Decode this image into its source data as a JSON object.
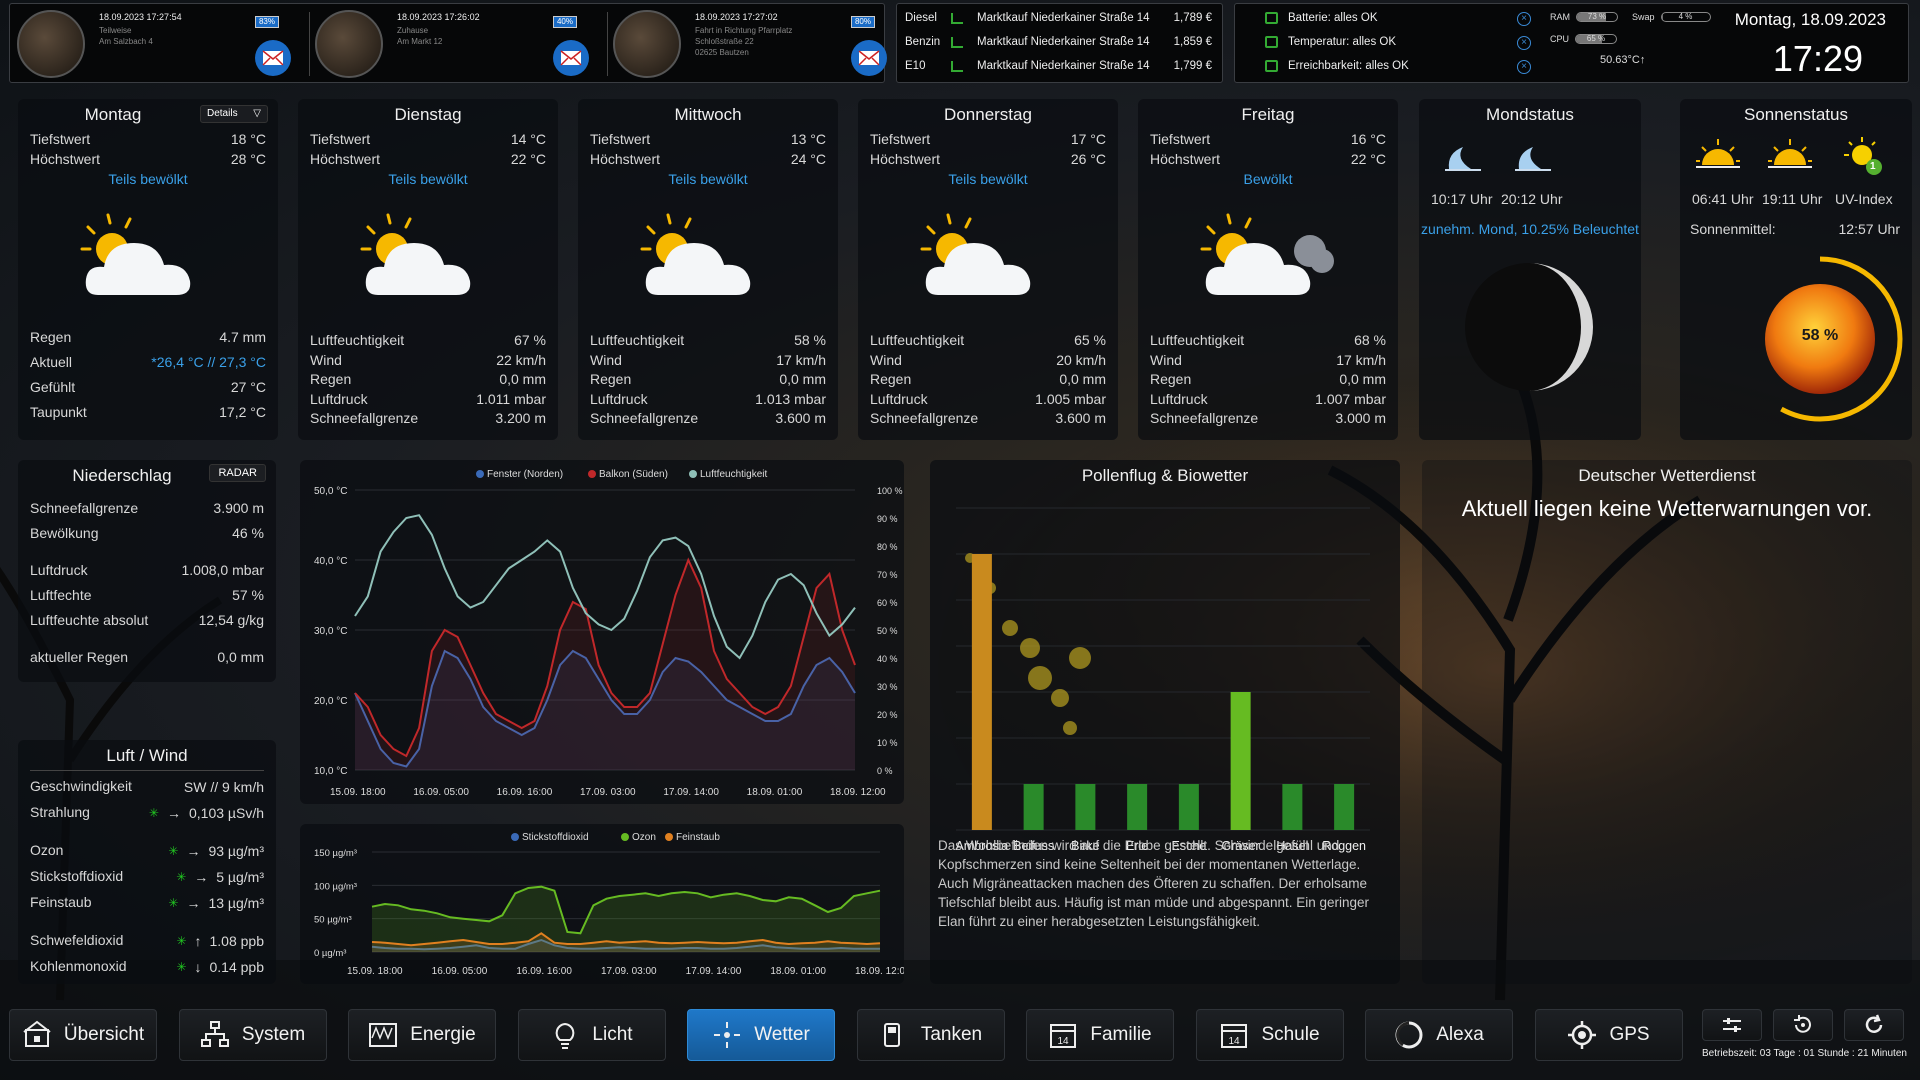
{
  "top": {
    "devices": [
      {
        "time": "18.09.2023 17:27:54",
        "lines": [
          "Teilweise",
          "Am Salzbach 4"
        ],
        "battery": "83%"
      },
      {
        "time": "18.09.2023 17:26:02",
        "lines": [
          "Zuhause",
          "Am Markt 12"
        ],
        "battery": "40%"
      },
      {
        "time": "18.09.2023 17:27:02",
        "lines": [
          "Fahrt in Richtung Pfarrplatz",
          "Schloßstraße 22",
          "02625 Bautzen"
        ],
        "battery": "80%"
      }
    ],
    "fuel": [
      {
        "type": "Diesel",
        "station": "Marktkauf Niederkainer Straße 14",
        "price": "1,789 €"
      },
      {
        "type": "Benzin",
        "station": "Marktkauf Niederkainer Straße 14",
        "price": "1,859 €"
      },
      {
        "type": "E10",
        "station": "Marktkauf Niederkainer Straße 14",
        "price": "1,799 €"
      }
    ],
    "status": [
      "Batterie: alles OK",
      "Temperatur: alles OK",
      "Erreichbarkeit: alles OK"
    ],
    "ram_label": "RAM",
    "ram_value": "73 %",
    "ram_fill": 0.73,
    "swap_label": "Swap",
    "swap_value": "4 %",
    "swap_fill": 0.04,
    "cpu_label": "CPU",
    "cpu_value": "65 %",
    "cpu_fill": 0.65,
    "cpu_temp": "50.63°C↑",
    "date": "Montag, 18.09.2023",
    "time": "17:29"
  },
  "days": [
    {
      "name": "Montag",
      "details": "Details",
      "low_label": "Tiefstwert",
      "low": "18 °C",
      "high_label": "Höchstwert",
      "high": "28 °C",
      "cond": "Teils bewölkt",
      "rows": [
        [
          "Regen",
          "4.7 mm"
        ],
        [
          "Aktuell",
          "*26,4 °C // 27,3 °C"
        ],
        [
          "Gefühlt",
          "27 °C"
        ],
        [
          "Taupunkt",
          "17,2 °C"
        ]
      ]
    },
    {
      "name": "Dienstag",
      "low_label": "Tiefstwert",
      "low": "14 °C",
      "high_label": "Höchstwert",
      "high": "22 °C",
      "cond": "Teils bewölkt",
      "rows": [
        [
          "Luftfeuchtigkeit",
          "67 %"
        ],
        [
          "Wind",
          "22 km/h"
        ],
        [
          "Regen",
          "0,0 mm"
        ],
        [
          "Luftdruck",
          "1.011 mbar"
        ],
        [
          "Schneefallgrenze",
          "3.200 m"
        ]
      ]
    },
    {
      "name": "Mittwoch",
      "low_label": "Tiefstwert",
      "low": "13 °C",
      "high_label": "Höchstwert",
      "high": "24 °C",
      "cond": "Teils bewölkt",
      "rows": [
        [
          "Luftfeuchtigkeit",
          "58 %"
        ],
        [
          "Wind",
          "17 km/h"
        ],
        [
          "Regen",
          "0,0 mm"
        ],
        [
          "Luftdruck",
          "1.013 mbar"
        ],
        [
          "Schneefallgrenze",
          "3.600 m"
        ]
      ]
    },
    {
      "name": "Donnerstag",
      "low_label": "Tiefstwert",
      "low": "17 °C",
      "high_label": "Höchstwert",
      "high": "26 °C",
      "cond": "Teils bewölkt",
      "rows": [
        [
          "Luftfeuchtigkeit",
          "65 %"
        ],
        [
          "Wind",
          "20 km/h"
        ],
        [
          "Regen",
          "0,0 mm"
        ],
        [
          "Luftdruck",
          "1.005 mbar"
        ],
        [
          "Schneefallgrenze",
          "3.600 m"
        ]
      ]
    },
    {
      "name": "Freitag",
      "low_label": "Tiefstwert",
      "low": "16 °C",
      "high_label": "Höchstwert",
      "high": "22 °C",
      "cond": "Bewölkt",
      "rows": [
        [
          "Luftfeuchtigkeit",
          "68 %"
        ],
        [
          "Wind",
          "17 km/h"
        ],
        [
          "Regen",
          "0,0 mm"
        ],
        [
          "Luftdruck",
          "1.007 mbar"
        ],
        [
          "Schneefallgrenze",
          "3.000 m"
        ]
      ]
    }
  ],
  "moon": {
    "title": "Mondstatus",
    "rise": "10:17 Uhr",
    "set": "20:12 Uhr",
    "phase": "zunehm. Mond, 10.25% Beleuchtet"
  },
  "sun": {
    "title": "Sonnenstatus",
    "rise": "06:41 Uhr",
    "set": "19:11 Uhr",
    "uv": "UV-Index",
    "uv_value": "1",
    "noon_label": "Sonnenmittel:",
    "noon": "12:57 Uhr",
    "percent": "58 %",
    "percent_fill": 0.58
  },
  "niederschlag": {
    "title": "Niederschlag",
    "radar": "RADAR",
    "rows": [
      [
        "Schneefallgrenze",
        "3.900 m"
      ],
      [
        "Bewölkung",
        "46 %"
      ],
      [
        "Luftdruck",
        "1.008,0 mbar"
      ],
      [
        "Luftfechte",
        "57 %"
      ],
      [
        "Luftfeuchte absolut",
        "12,54 g/kg"
      ],
      [
        "aktueller Regen",
        "0,0 mm"
      ]
    ]
  },
  "luftwind": {
    "title": "Luft / Wind",
    "rows": [
      [
        "Geschwindigkeit",
        "",
        "",
        "SW // 9 km/h"
      ],
      [
        "Strahlung",
        "lamp",
        "→",
        "0,103 µSv/h"
      ],
      [
        "Ozon",
        "lamp",
        "→",
        "93 µg/m³"
      ],
      [
        "Stickstoffdioxid",
        "lamp",
        "→",
        "5 µg/m³"
      ],
      [
        "Feinstaub",
        "lamp",
        "→",
        "13 µg/m³"
      ],
      [
        "Schwefeldioxid",
        "lamp",
        "↑",
        "1.08 ppb"
      ],
      [
        "Kohlenmonoxid",
        "lamp",
        "↓",
        "0.14 ppb"
      ]
    ]
  },
  "pollen": {
    "title": "Pollenflug & Biowetter",
    "text": "Das Wohlbefinden wird auf die Probe gestellt. Schwindelgefühl und Kopfschmerzen sind keine Seltenheit bei der momentanen Wetterlage. Auch Migräneattacken machen des Öfteren zu schaffen. Der erholsame Tiefschlaf bleibt aus. Häufig ist man müde und abgespannt. Ein geringer Elan führt zu einer herabgesetzten Leistungsfähigkeit."
  },
  "dwd": {
    "title": "Deutscher Wetterdienst",
    "message": "Aktuell liegen keine Wetterwarnungen vor."
  },
  "nav": [
    "Übersicht",
    "System",
    "Energie",
    "Licht",
    "Wetter",
    "Tanken",
    "Familie",
    "Schule",
    "Alexa",
    "GPS"
  ],
  "uptime": "Betriebszeit: 03 Tage : 01 Stunde : 21 Minuten",
  "chart_data": [
    {
      "type": "line",
      "legend": [
        "Fenster (Norden)",
        "Balkon (Süden)",
        "Luftfeuchtigkeit"
      ],
      "colors": [
        "#3a6ab8",
        "#c0282a",
        "#8fc0b8"
      ],
      "x_ticks": [
        "15.09. 18:00",
        "16.09. 05:00",
        "16.09. 16:00",
        "17.09. 03:00",
        "17.09. 14:00",
        "18.09. 01:00",
        "18.09. 12:00"
      ],
      "y_left_ticks": [
        "50,0 °C",
        "40,0 °C",
        "30,0 °C",
        "20,0 °C",
        "10,0 °C"
      ],
      "y_right_ticks": [
        "100 %",
        "90 %",
        "80 %",
        "70 %",
        "60 %",
        "50 %",
        "40 %",
        "30 %",
        "20 %",
        "10 %",
        "0 %"
      ],
      "ylim_left": [
        10,
        50
      ],
      "ylim_right": [
        0,
        100
      ],
      "series": [
        {
          "name": "Fenster (Norden)",
          "axis": "left",
          "values": [
            21,
            17,
            13,
            11,
            10.5,
            13,
            22,
            27,
            26,
            23,
            19,
            17,
            16,
            15,
            16,
            20,
            25,
            27,
            26,
            23,
            20,
            18,
            18,
            20,
            24,
            26,
            25.5,
            24,
            22,
            20,
            19,
            18,
            17,
            17,
            18,
            22,
            25,
            26,
            24,
            21
          ]
        },
        {
          "name": "Balkon (Süden)",
          "axis": "left",
          "values": [
            21,
            19,
            15,
            13,
            12,
            16,
            27,
            30,
            29,
            25,
            21,
            18,
            17,
            16,
            17,
            22,
            30,
            34,
            33,
            25,
            21,
            19,
            19,
            21,
            28,
            35,
            40,
            36,
            27,
            23,
            21,
            19,
            18,
            19,
            22,
            29,
            36,
            38,
            30,
            25
          ]
        },
        {
          "name": "Luftfeuchtigkeit",
          "axis": "right",
          "values": [
            55,
            62,
            78,
            85,
            90,
            91,
            84,
            72,
            62,
            58,
            60,
            66,
            72,
            75,
            78,
            82,
            78,
            65,
            56,
            52,
            50,
            54,
            64,
            76,
            82,
            83,
            80,
            70,
            55,
            44,
            40,
            48,
            60,
            68,
            70,
            66,
            56,
            48,
            52,
            58
          ]
        }
      ]
    },
    {
      "type": "line",
      "legend": [
        "Stickstoffdioxid",
        "Ozon",
        "Feinstaub"
      ],
      "colors": [
        "#3a6ab8",
        "#66bb22",
        "#e08020"
      ],
      "x_ticks": [
        "15.09. 18:00",
        "16.09. 05:00",
        "16.09. 16:00",
        "17.09. 03:00",
        "17.09. 14:00",
        "18.09. 01:00",
        "18.09. 12:00"
      ],
      "y_ticks": [
        "150 µg/m³",
        "100 µg/m³",
        "50 µg/m³",
        "0 µg/m³"
      ],
      "ylim": [
        0,
        150
      ],
      "series": [
        {
          "name": "Stickstoffdioxid",
          "values": [
            8,
            6,
            5,
            5,
            4,
            5,
            6,
            8,
            10,
            6,
            5,
            5,
            12,
            18,
            10,
            6,
            5,
            5,
            6,
            7,
            6,
            5,
            5,
            5,
            6,
            6,
            5,
            5,
            6,
            8,
            10,
            7,
            6,
            5,
            5,
            5,
            6,
            5,
            5,
            5
          ]
        },
        {
          "name": "Ozon",
          "values": [
            68,
            72,
            70,
            64,
            62,
            58,
            52,
            50,
            48,
            46,
            55,
            88,
            96,
            98,
            92,
            30,
            28,
            70,
            80,
            84,
            86,
            88,
            84,
            88,
            90,
            88,
            82,
            86,
            88,
            84,
            78,
            76,
            82,
            80,
            70,
            60,
            66,
            84,
            88,
            92
          ]
        },
        {
          "name": "Feinstaub",
          "values": [
            15,
            14,
            12,
            10,
            12,
            14,
            16,
            18,
            15,
            12,
            12,
            14,
            16,
            28,
            14,
            12,
            12,
            14,
            16,
            14,
            15,
            16,
            14,
            13,
            14,
            15,
            14,
            13,
            14,
            16,
            18,
            14,
            12,
            13,
            14,
            16,
            14,
            13,
            12,
            13
          ]
        }
      ]
    },
    {
      "type": "bar",
      "categories": [
        "Ambrosia",
        "Beifuss",
        "Birke",
        "Erle",
        "Esche",
        "Gräser",
        "Hasel",
        "Roggen"
      ],
      "values": [
        3,
        0.5,
        0.5,
        0.5,
        0.5,
        1.5,
        0.5,
        0.5
      ],
      "ylim": [
        0,
        3.5
      ],
      "colors": [
        "#c98a1e",
        "#2a8a2a",
        "#2a8a2a",
        "#2a8a2a",
        "#2a8a2a",
        "#66bb22",
        "#2a8a2a",
        "#2a8a2a"
      ]
    }
  ]
}
